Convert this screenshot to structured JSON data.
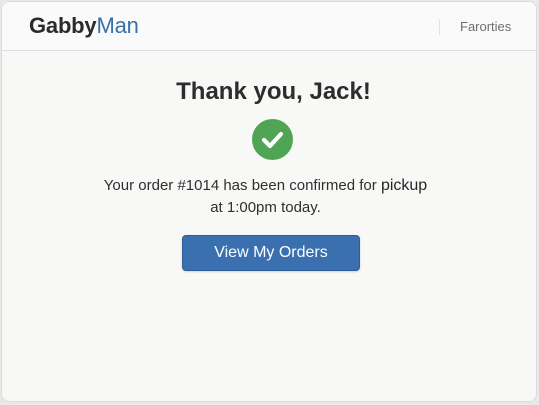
{
  "header": {
    "logo_part1": "Gabby",
    "logo_part2": "Man",
    "nav_link": "Farorties"
  },
  "confirmation": {
    "title": "Thank you, Jack!",
    "message_line1_prefix": "Your order #1014 has been confirmed for ",
    "message_line1_emphasis": "pickup",
    "message_line2": "at 1:00pm today.",
    "button_label": "View My Orders",
    "icon": "checkmark-icon"
  },
  "colors": {
    "brand_blue": "#3a6fa8",
    "button_blue": "#3a6fb0",
    "success_green": "#4fa553"
  }
}
